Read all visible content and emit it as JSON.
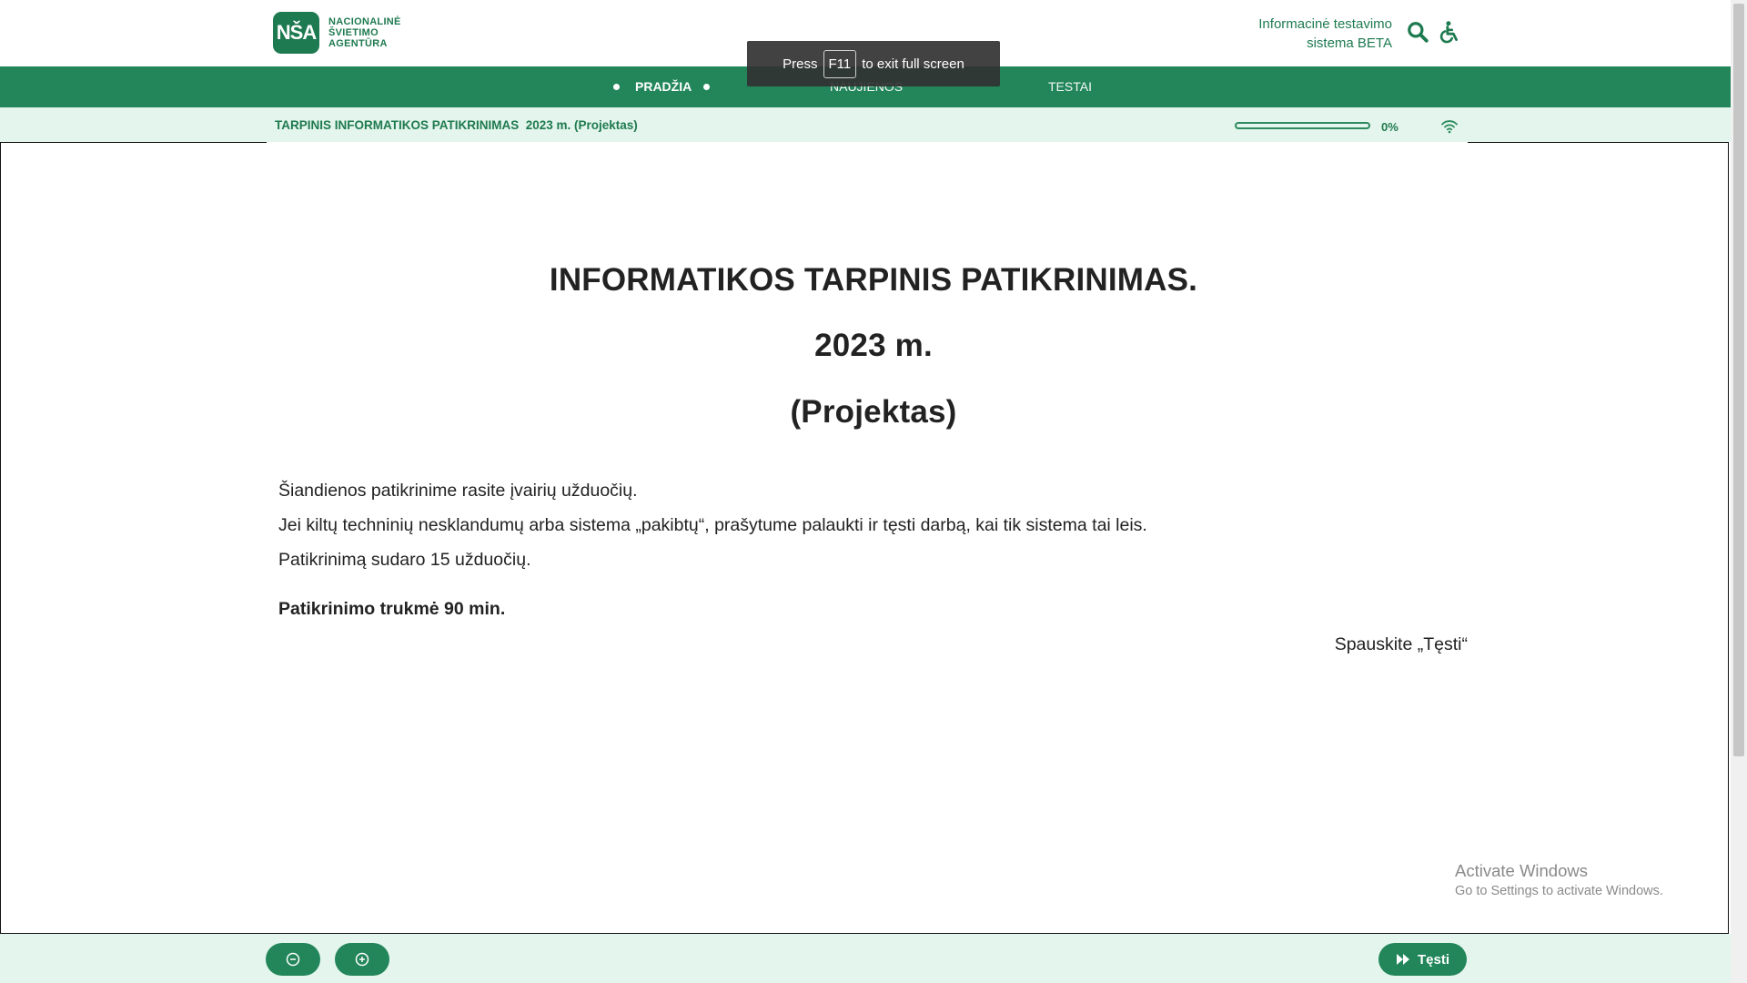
{
  "header": {
    "logo_mark": "NŠA",
    "logo_lines": [
      "NACIONALINĖ",
      "ŠVIETIMO",
      "AGENTŪRA"
    ],
    "system_name_line1": "Informacinė testavimo",
    "system_name_line2": "sistema BETA",
    "icons": [
      "search-icon",
      "accessibility-icon"
    ],
    "accent_color": "#22865a"
  },
  "nav": {
    "items": [
      {
        "label": "PRADŽIA",
        "active": true
      },
      {
        "label": "NAUJIENOS",
        "active": false
      },
      {
        "label": "TESTAI",
        "active": false
      }
    ]
  },
  "fullscreen_notice": {
    "prefix": "Press",
    "key": "F11",
    "suffix": "to exit full screen"
  },
  "test_bar": {
    "title": "TARPINIS INFORMATIKOS PATIKRINIMAS  2023 m. (Projektas)",
    "progress": 0,
    "progress_label": "0%",
    "connection_icon": "wifi-icon"
  },
  "content": {
    "heading_line1": "INFORMATIKOS TARPINIS PATIKRINIMAS.",
    "heading_line2": "2023 m.",
    "heading_line3": "(Projektas)",
    "paragraph1": "Šiandienos patikrinime rasite įvairių užduočių.",
    "paragraph2": "Jei kiltų techninių nesklandumų arba sistema „pakibtų“, prašytume palaukti ir tęsti darbą, kai tik sistema tai leis.",
    "paragraph3": "Patikrinimą sudaro 15 užduočių.",
    "duration": "Patikrinimo trukmė 90 min.",
    "continue_hint": "Spauskite „Tęsti“"
  },
  "watermark": {
    "line1": "Activate Windows",
    "line2": "Go to Settings to activate Windows."
  },
  "footer": {
    "zoom_out_icon": "zoom-out-icon",
    "zoom_in_icon": "zoom-in-icon",
    "next_label": "Tęsti",
    "next_icon": "fast-forward-icon"
  }
}
